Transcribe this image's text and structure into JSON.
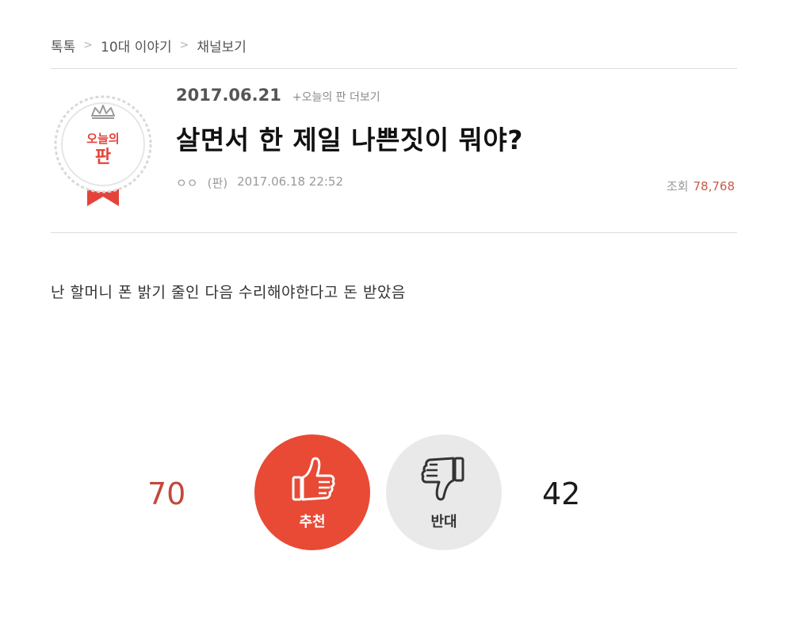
{
  "breadcrumb": {
    "items": [
      "톡톡",
      "10대 이야기",
      "채널보기"
    ],
    "separator": ">"
  },
  "badge": {
    "line1": "오늘의",
    "line2": "판",
    "crown_icon": "crown-icon",
    "colors": {
      "red": "#e5433a",
      "ring": "#d9d9d9"
    }
  },
  "post": {
    "date": "2017.06.21",
    "more_link": "+오늘의 판 더보기",
    "title": "살면서 한 제일 나쁜짓이 뭐야?",
    "author": "ㅇㅇ",
    "source": "(판)",
    "timestamp": "2017.06.18 22:52",
    "views_label": "조회",
    "views_count": "78,768",
    "body": "난 할머니 폰 밝기 줄인 다음 수리해야한다고 돈 받았음"
  },
  "votes": {
    "up_count": "70",
    "up_label": "추천",
    "up_icon": "thumbs-up-icon",
    "down_count": "42",
    "down_label": "반대",
    "down_icon": "thumbs-down-icon",
    "colors": {
      "up": "#e84a35",
      "down": "#e9e9e9"
    }
  }
}
